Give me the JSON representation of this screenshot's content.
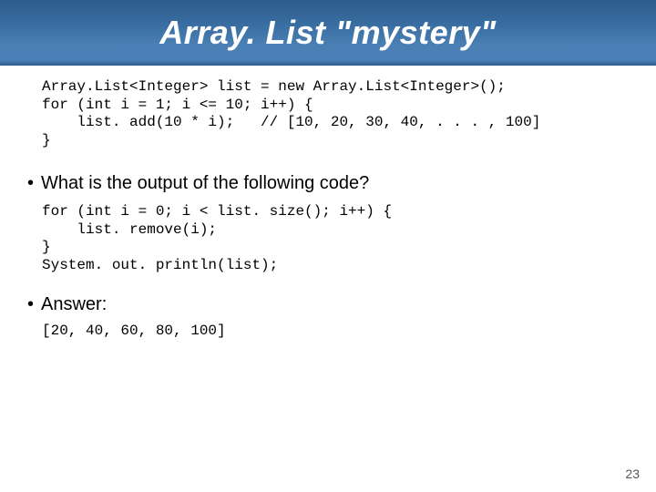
{
  "title": "Array. List \"mystery\"",
  "code_block_1_lines": [
    "Array.List<Integer> list = new Array.List<Integer>();",
    "for (int i = 1; i <= 10; i++) {",
    "    list. add(10 * i);   // [10, 20, 30, 40, . . . , 100]",
    "}"
  ],
  "question_bullet": "What is the output of the following code?",
  "code_block_2_lines": [
    "for (int i = 0; i < list. size(); i++) {",
    "    list. remove(i);",
    "}",
    "System. out. println(list);"
  ],
  "answer_bullet": "Answer:",
  "answer_code": "[20, 40, 60, 80, 100]",
  "page_number": "23"
}
